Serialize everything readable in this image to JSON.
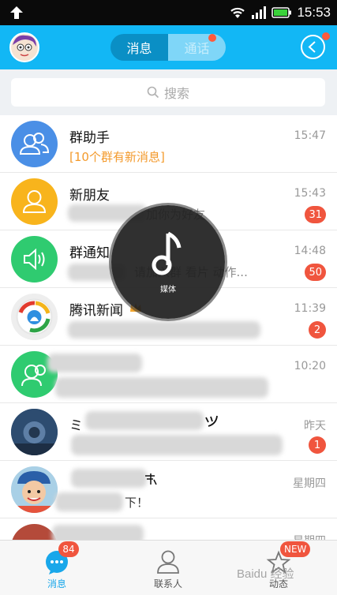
{
  "status_bar": {
    "time": "15:53"
  },
  "header": {
    "tabs": [
      {
        "label": "消息",
        "active": true
      },
      {
        "label": "通话",
        "active": false
      }
    ]
  },
  "search": {
    "placeholder": "搜索"
  },
  "conversations": [
    {
      "name": "群助手",
      "preview": "[10个群有新消息]",
      "time": "15:47",
      "badge": ""
    },
    {
      "name": "新朋友",
      "preview": "加你为好友",
      "time": "15:43",
      "badge": "31"
    },
    {
      "name": "群通知",
      "preview": "请加入群 看片 动作...",
      "time": "14:48",
      "badge": "50"
    },
    {
      "name": "腾讯新闻",
      "preview": "",
      "time": "11:39",
      "badge": "2"
    },
    {
      "name": "",
      "preview": "",
      "time": "10:20",
      "badge": ""
    },
    {
      "name": "ミ",
      "preview": "",
      "time": "昨天",
      "badge": "1"
    },
    {
      "name": "",
      "preview": "下！",
      "time": "星期四",
      "badge": ""
    },
    {
      "name": "",
      "preview": "",
      "time": "星期四",
      "badge": ""
    }
  ],
  "media_overlay": {
    "label": "媒体"
  },
  "tabbar": {
    "tabs": [
      {
        "label": "消息",
        "badge": "84",
        "active": true
      },
      {
        "label": "联系人",
        "badge": "",
        "active": false
      },
      {
        "label": "动态",
        "badge": "NEW",
        "active": false
      }
    ]
  },
  "watermark": "Baidu 经验",
  "colors": {
    "accent": "#12b7f5",
    "badge": "#f0553e",
    "orange_text": "#f39a2c"
  }
}
